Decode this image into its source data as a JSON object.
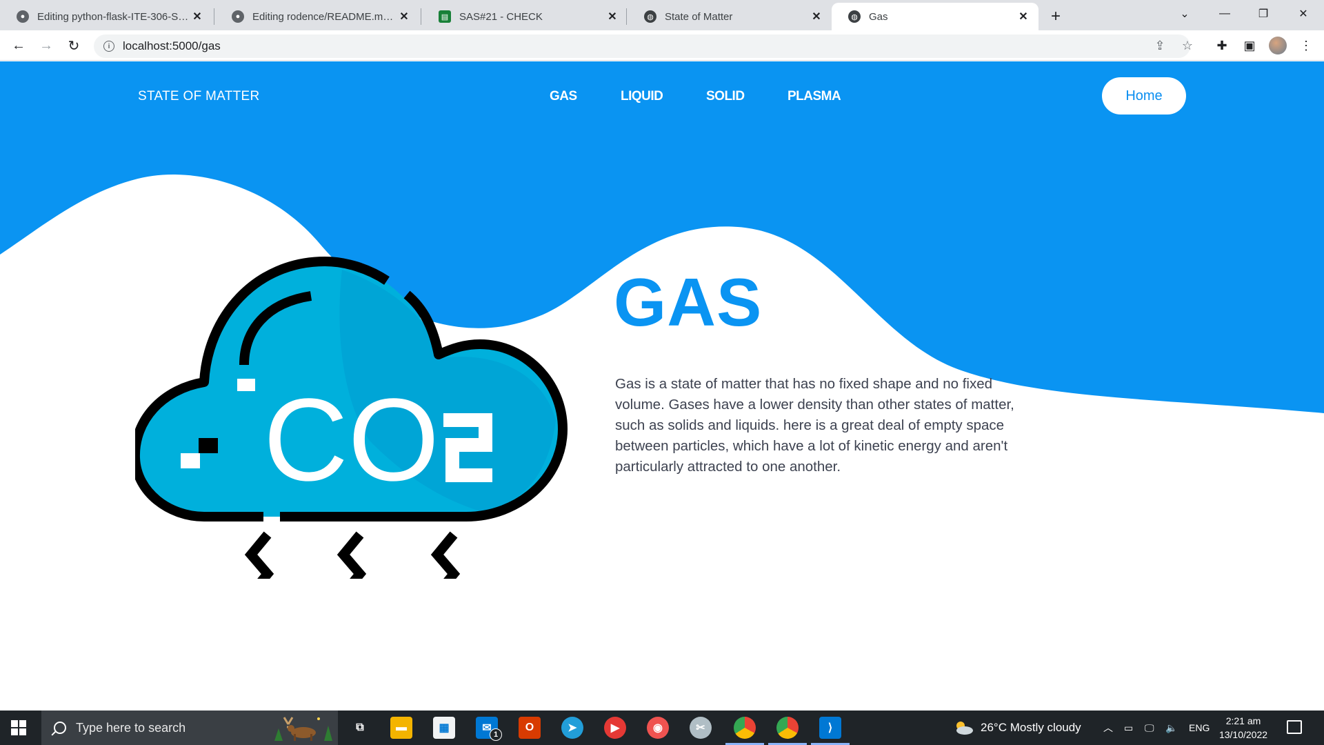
{
  "browser": {
    "tabs": [
      {
        "title": "Editing python-flask-ITE-306-SAS",
        "icon": "github-icon",
        "active": false
      },
      {
        "title": "Editing rodence/README.md at main",
        "icon": "github-icon",
        "active": false
      },
      {
        "title": "SAS#21 - CHECK",
        "icon": "sheets-icon",
        "active": false
      },
      {
        "title": "State of Matter",
        "icon": "globe-icon",
        "active": false
      },
      {
        "title": "Gas",
        "icon": "globe-icon",
        "active": true
      }
    ],
    "url": "localhost:5000/gas"
  },
  "site": {
    "brand": "STATE OF MATTER",
    "nav": [
      "GAS",
      "LIQUID",
      "SOLID",
      "PLASMA"
    ],
    "home_button": "Home",
    "heading": "GAS",
    "description": "Gas is a state of matter that has no fixed shape and no fixed volume. Gases have a lower density than other states of matter, such as solids and liquids. here is a great deal of empty space between particles, which have a lot of kinetic energy and aren't particularly attracted to one another.",
    "illustration": "co2-cloud-icon",
    "colors": {
      "primary": "#0a94f2",
      "cloud": "#00b0dc"
    }
  },
  "taskbar": {
    "search_placeholder": "Type here to search",
    "mail_badge": "1",
    "weather": "26°C  Mostly cloudy",
    "language": "ENG",
    "time": "2:21 am",
    "date": "13/10/2022"
  }
}
